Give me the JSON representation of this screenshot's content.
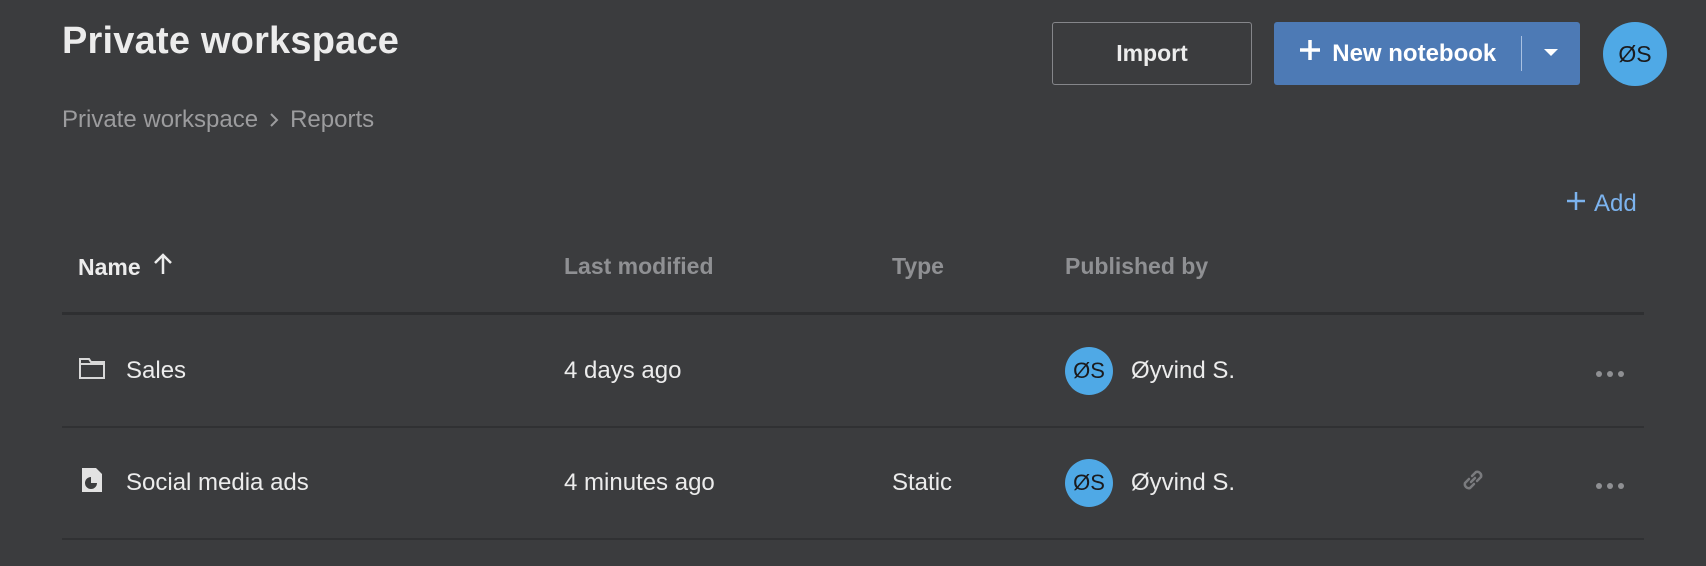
{
  "header": {
    "title": "Private workspace",
    "breadcrumb": [
      "Private workspace",
      "Reports"
    ],
    "import_label": "Import",
    "new_notebook_label": "New notebook",
    "user_initials": "ØS"
  },
  "toolbar": {
    "add_label": "Add"
  },
  "table": {
    "columns": [
      "Name",
      "Last modified",
      "Type",
      "Published by"
    ],
    "sort": {
      "column": "Name",
      "direction": "ascending"
    },
    "rows": [
      {
        "icon": "folder-icon",
        "name": "Sales",
        "modified": "4 days ago",
        "type": "",
        "publisher_initials": "ØS",
        "publisher": "Øyvind S.",
        "has_link": false
      },
      {
        "icon": "notebook-icon",
        "name": "Social media ads",
        "modified": "4 minutes ago",
        "type": "Static",
        "publisher_initials": "ØS",
        "publisher": "Øyvind S.",
        "has_link": true
      }
    ]
  },
  "colors": {
    "background": "#3b3c3e",
    "accent": "#4d7ab5",
    "avatar": "#4fa9e6",
    "link": "#7cb3ee"
  }
}
